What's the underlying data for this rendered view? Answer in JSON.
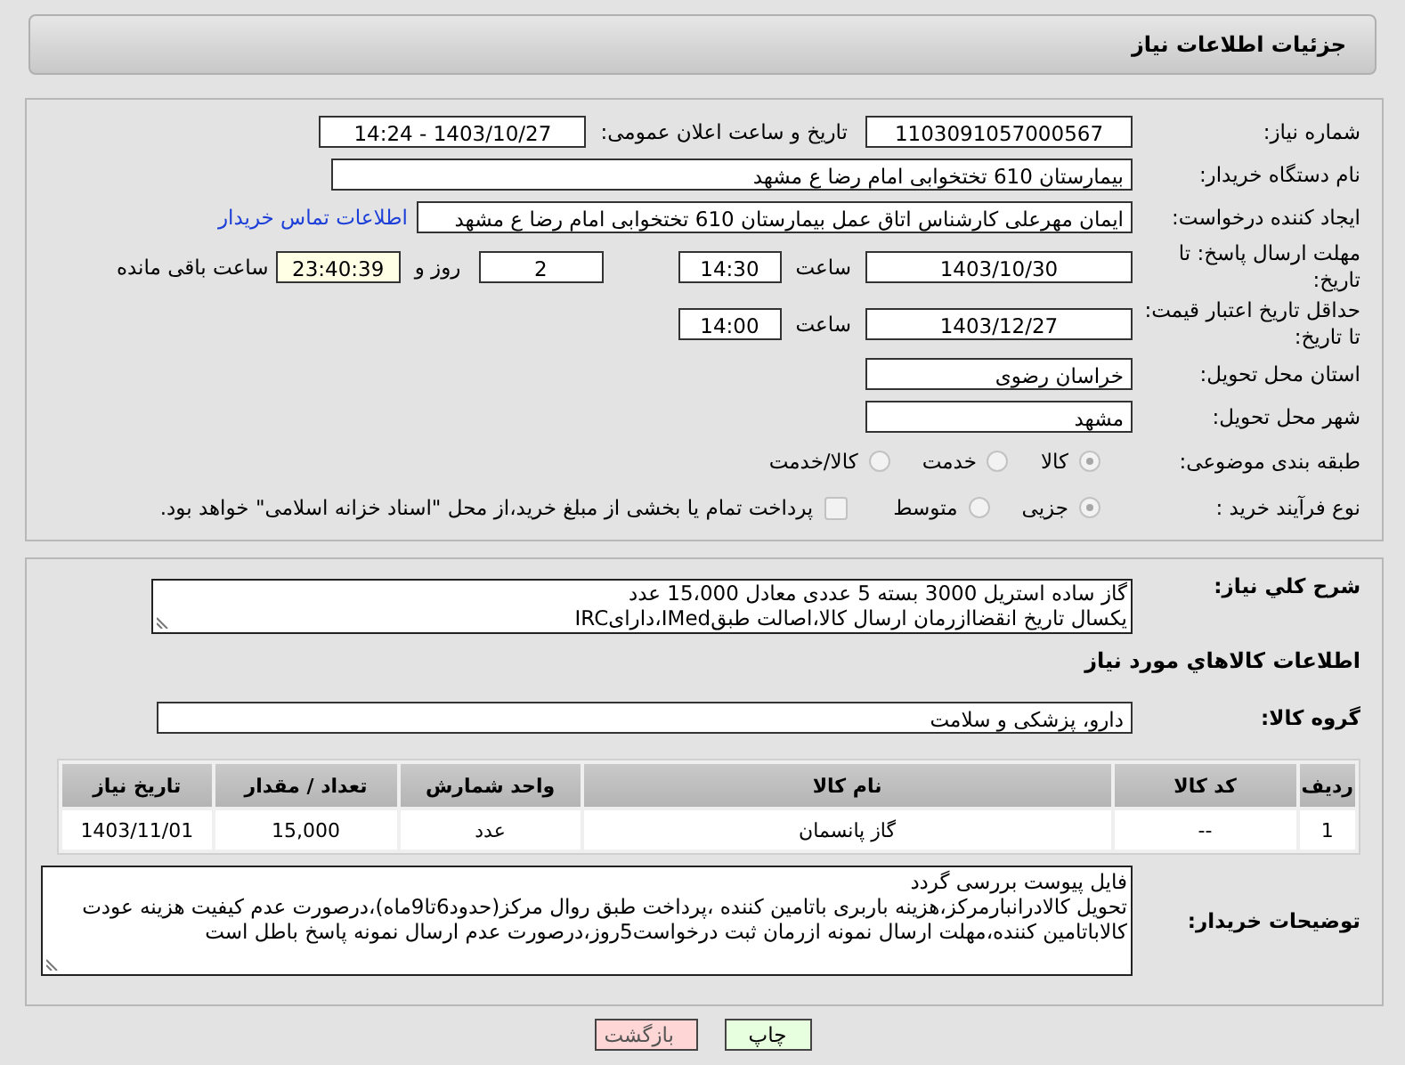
{
  "header": {
    "title": "جزئیات اطلاعات نیاز"
  },
  "need_number": {
    "label": "شماره نیاز:",
    "value": "1103091057000567"
  },
  "announce_datetime": {
    "label": "تاریخ و ساعت اعلان عمومی:",
    "value": "1403/10/27 - 14:24"
  },
  "buyer_org": {
    "label": "نام دستگاه خریدار:",
    "value": "بیمارستان 610 تختخوابی امام رضا ع  مشهد"
  },
  "requester": {
    "label": "ایجاد کننده درخواست:",
    "value": "ایمان مهرعلی کارشناس اتاق عمل بیمارستان 610 تختخوابی امام رضا ع  مشهد",
    "link": "اطلاعات تماس خریدار"
  },
  "reply_deadline": {
    "label": "مهلت ارسال پاسخ: تا تاریخ:",
    "date": "1403/10/30",
    "time_label": "ساعت",
    "time": "14:30",
    "days": "2",
    "days_label": "روز و",
    "remaining": "23:40:39",
    "remaining_label": "ساعت باقی مانده"
  },
  "price_validity": {
    "label": "حداقل تاریخ اعتبار قیمت: تا تاریخ:",
    "date": "1403/12/27",
    "time_label": "ساعت",
    "time": "14:00"
  },
  "province": {
    "label": "استان محل تحویل:",
    "value": "خراسان رضوی"
  },
  "city": {
    "label": "شهر محل تحویل:",
    "value": "مشهد"
  },
  "category": {
    "label": "طبقه بندی موضوعی:",
    "options": [
      {
        "label": "کالا",
        "selected": true
      },
      {
        "label": "خدمت",
        "selected": false
      },
      {
        "label": "کالا/خدمت",
        "selected": false
      }
    ]
  },
  "purchase_type": {
    "label": "نوع فرآیند خرید :",
    "options": [
      {
        "label": "جزیی",
        "selected": true
      },
      {
        "label": "متوسط",
        "selected": false
      }
    ],
    "checkbox": {
      "label": "پرداخت تمام یا بخشی از مبلغ خرید،از محل \"اسناد خزانه اسلامی\" خواهد بود.",
      "checked": false
    }
  },
  "description": {
    "label": "شرح کلي نياز:",
    "value": "گاز ساده استریل 3000 بسته 5 عددی معادل 15،000 عدد\nیکسال تاریخ انقضاازرمان ارسال کالا،اصالت طبقIMed،دارایIRC"
  },
  "goods": {
    "title": "اطلاعات کالاهاي مورد نياز",
    "group": {
      "label": "گروه کالا:",
      "value": "دارو، پزشکی و سلامت"
    },
    "table": {
      "columns": [
        "ردیف",
        "کد کالا",
        "نام کالا",
        "واحد شمارش",
        "تعداد / مقدار",
        "تاریخ نیاز"
      ],
      "rows": [
        [
          "1",
          "--",
          "گاز پانسمان",
          "عدد",
          "15,000",
          "1403/11/01"
        ]
      ]
    }
  },
  "buyer_notes": {
    "label": "توضیحات خریدار:",
    "value": "فایل پیوست بررسی گردد\nتحویل کالادرانبارمرکز،هزینه باربری باتامین کننده ،پرداخت طبق روال مرکز(حدود6تا9ماه)،درصورت عدم کیفیت هزینه عودت کالاباتامین کننده،مهلت ارسال نمونه ازرمان ثبت درخواست5روز،درصورت عدم ارسال نمونه پاسخ باطل است"
  },
  "buttons": [
    {
      "label": "چاپ",
      "kind": "print"
    },
    {
      "label": "بازگشت",
      "kind": "back"
    }
  ]
}
